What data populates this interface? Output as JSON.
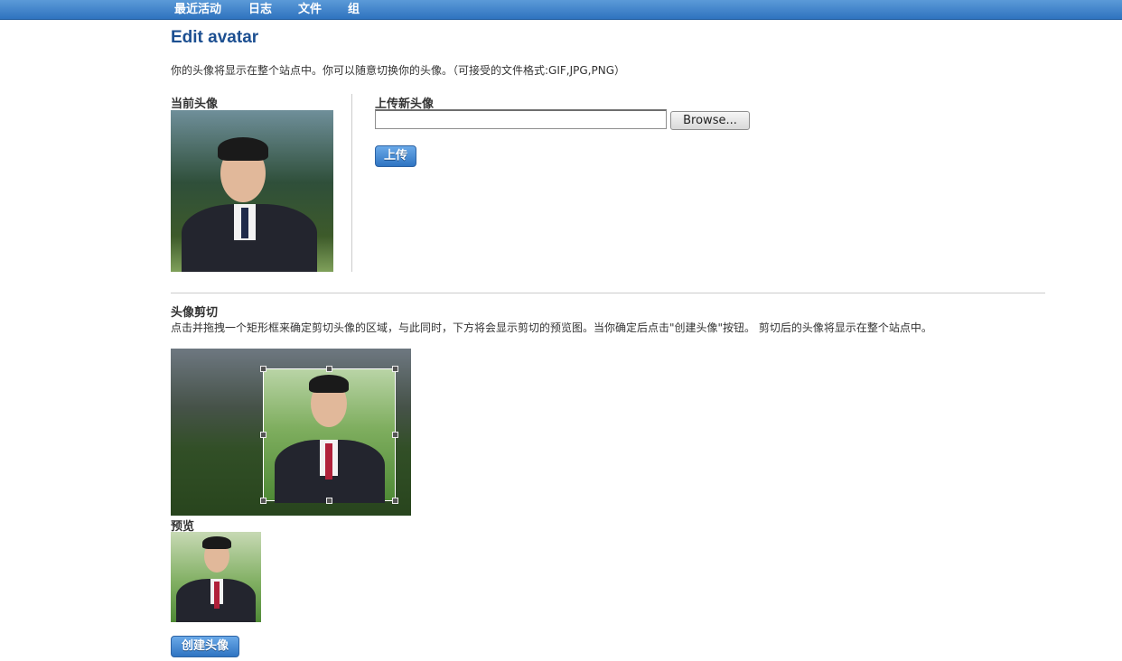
{
  "nav": {
    "items": [
      "最近活动",
      "日志",
      "文件",
      "组"
    ]
  },
  "page_title": "Edit avatar",
  "intro_text": "你的头像将显示在整个站点中。你可以随意切换你的头像。（可接受的文件格式:GIF,JPG,PNG）",
  "current_avatar": {
    "label": "当前头像"
  },
  "upload": {
    "label": "上传新头像",
    "file_value": "",
    "browse_label": "Browse...",
    "submit_label": "上传"
  },
  "crop": {
    "label": "头像剪切",
    "instructions": "点击并拖拽一个矩形框来确定剪切头像的区域，与此同时，下方将会显示剪切的预览图。当你确定后点击\"创建头像\"按钮。 剪切后的头像将显示在整个站点中。"
  },
  "preview": {
    "label": "预览"
  },
  "create_button_label": "创建头像",
  "colors": {
    "nav_bar": "#3a7ec9",
    "title": "#1c4f91",
    "button_blue": "#3a7ec9"
  }
}
